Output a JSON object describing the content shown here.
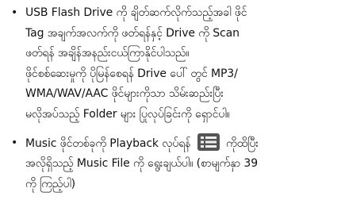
{
  "items": [
    {
      "bullet": "•",
      "lines": [
        "USB Flash Drive ကို ချိတ်ဆက်လိုက်သည့်အခါ ဖိုင်",
        "Tag အချက်အလက်ကို ဖတ်ရန်နှင့် Drive ကို Scan",
        "ဖတ်ရန် အချိန်အနည်းငယ်ကြာနိုင်ပါသည်။",
        "ဖိုင်စစ်ဆေးမှုကို ပိုမြန်စေရန် Drive ပေါ် တွင် MP3/",
        "WMA/WAV/AAC ဖိုင်များကိုသာ သိမ်းဆည်းပြီး",
        "မလိုအပ်သည့် Folder များ ပြုလုပ်ခြင်းကို ရှောင်ပါ။"
      ]
    },
    {
      "bullet": "•",
      "line1_before_icon": "Music ဖိုင်တစ်ခုကို Playback လုပ်ရန်",
      "line1_after_icon": "ကိုထိပြီး",
      "icon": "list-menu-icon",
      "lines_rest": [
        "အလိုရှိသည့် Music File ကို ရွေးချယ်ပါ။ (စာမျက်နှာ 39",
        "ကို ကြည့်ပါ)"
      ]
    }
  ],
  "colors": {
    "text": "#111111",
    "icon_bg": "#555555",
    "icon_fg": "#f0f0f0"
  }
}
